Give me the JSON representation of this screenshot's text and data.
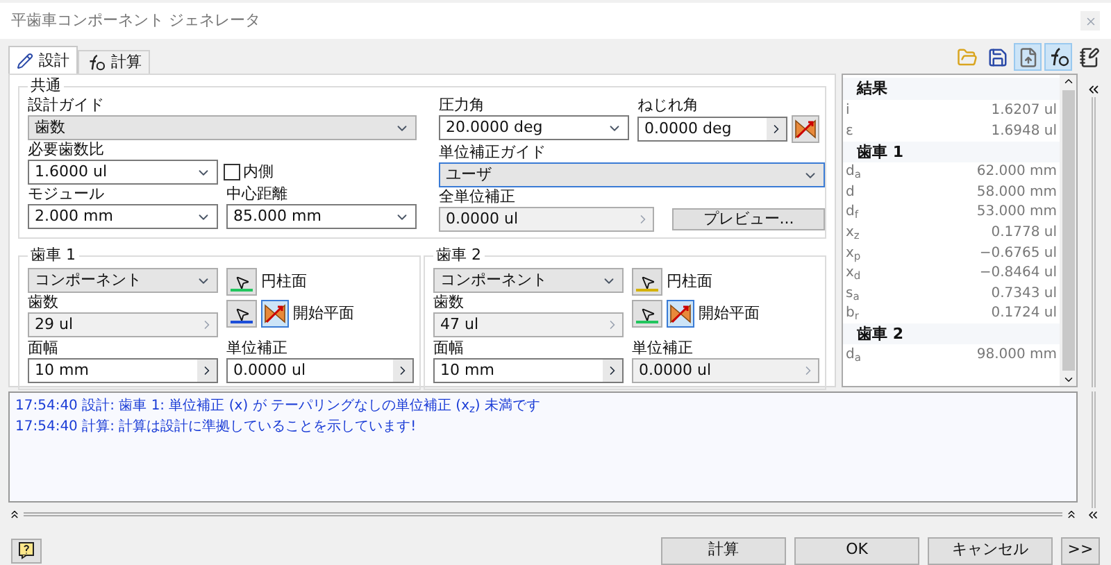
{
  "window": {
    "title": "平歯車コンポーネント ジェネレータ"
  },
  "tabs": [
    {
      "label": "設計",
      "selected": true,
      "kind": "design"
    },
    {
      "label": "計算",
      "selected": false,
      "kind": "calc"
    }
  ],
  "toolbar": [
    {
      "kind": "open",
      "pressed": false
    },
    {
      "kind": "save",
      "pressed": false
    },
    {
      "kind": "export",
      "pressed": true
    },
    {
      "kind": "formula",
      "pressed": true
    },
    {
      "kind": "notes",
      "pressed": false
    }
  ],
  "common": {
    "title": "共通",
    "design_guide": {
      "label": "設計ガイド",
      "value": "歯数"
    },
    "ratio": {
      "label": "必要歯数比",
      "value": "1.6000 ul"
    },
    "internal": {
      "label": "内側",
      "checked": false
    },
    "module": {
      "label": "モジュール",
      "value": "2.000 mm"
    },
    "center_distance": {
      "label": "中心距離",
      "value": "85.000 mm"
    },
    "pressure_angle": {
      "label": "圧力角",
      "value": "20.0000 deg"
    },
    "helix_angle": {
      "label": "ねじれ角",
      "value": "0.0000 deg",
      "disabled": false
    },
    "correction_guide": {
      "label": "単位補正ガイド",
      "value": "ユーザ"
    },
    "total_correction": {
      "label": "全単位補正",
      "value": "0.0000 ul",
      "disabled": true
    },
    "preview_button": "プレビュー..."
  },
  "gears": [
    {
      "title": "歯車 1",
      "component": "コンポーネント",
      "cylinder": {
        "label": "円柱面",
        "color": "#22c55e"
      },
      "start_plane": {
        "label": "開始平面",
        "color": "#1d4ed8"
      },
      "teeth": {
        "label": "歯数",
        "value": "29 ul",
        "disabled": true
      },
      "face_width": {
        "label": "面幅",
        "value": "10 mm",
        "disabled": false
      },
      "correction": {
        "label": "単位補正",
        "value": "0.0000 ul",
        "disabled": false
      }
    },
    {
      "title": "歯車 2",
      "component": "コンポーネント",
      "cylinder": {
        "label": "円柱面",
        "color": "#d4b106"
      },
      "start_plane": {
        "label": "開始平面",
        "color": "#22c55e"
      },
      "teeth": {
        "label": "歯数",
        "value": "47 ul",
        "disabled": true
      },
      "face_width": {
        "label": "面幅",
        "value": "10 mm",
        "disabled": false
      },
      "correction": {
        "label": "単位補正",
        "value": "0.0000 ul",
        "disabled": true
      }
    }
  ],
  "results": {
    "title": "結果",
    "rows": [
      {
        "kind": "value",
        "symbol": "i",
        "value": "1.6207 ul"
      },
      {
        "kind": "value",
        "symbol": "ε",
        "value": "1.6948 ul"
      },
      {
        "kind": "header",
        "symbol": "歯車 1"
      },
      {
        "kind": "value",
        "symbol": "d$_{a}$",
        "value": "62.000 mm"
      },
      {
        "kind": "value",
        "symbol": "d",
        "value": "58.000 mm"
      },
      {
        "kind": "value",
        "symbol": "d$_{f}$",
        "value": "53.000 mm"
      },
      {
        "kind": "value",
        "symbol": "x$_{z}$",
        "value": "0.1778 ul"
      },
      {
        "kind": "value",
        "symbol": "x$_{p}$",
        "value": "−0.6765 ul"
      },
      {
        "kind": "value",
        "symbol": "x$_{d}$",
        "value": "−0.8464 ul"
      },
      {
        "kind": "value",
        "symbol": "s$_{a}$",
        "value": "0.7343 ul"
      },
      {
        "kind": "value",
        "symbol": "b$_{r}$",
        "value": "0.1724 ul"
      },
      {
        "kind": "header",
        "symbol": "歯車 2"
      },
      {
        "kind": "value",
        "symbol": "d$_{a}$",
        "value": "98.000 mm"
      }
    ]
  },
  "messages": [
    "17:54:40 設計: 歯車 1: 単位補正 (x) が テーパリングなしの単位補正 (x$_{z}$) 未満です",
    "17:54:40 計算: 計算は設計に準拠していることを示しています!"
  ],
  "buttons": [
    {
      "label": "計算"
    },
    {
      "label": "OK"
    },
    {
      "label": "キャンセル"
    },
    {
      "label": ">>"
    }
  ]
}
